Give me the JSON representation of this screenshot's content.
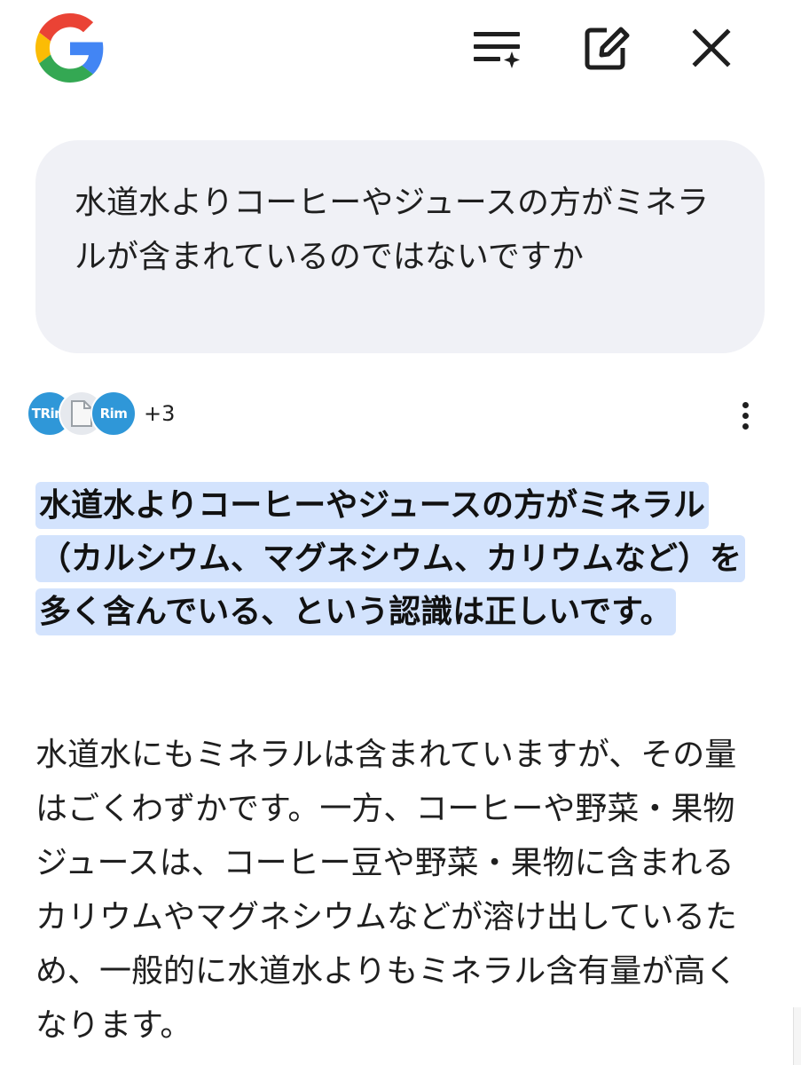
{
  "header": {
    "logo_icon": "google-g-logo-icon",
    "actions": [
      {
        "name": "sparkle-list-icon"
      },
      {
        "name": "edit-icon"
      },
      {
        "name": "close-icon"
      }
    ]
  },
  "user_query": {
    "text": "水道水よりコーヒーやジュースの方がミネラルが含まれているのではないですか"
  },
  "sources": {
    "avatars": [
      {
        "label": "TRim"
      },
      {
        "label": ""
      },
      {
        "label": "Rim"
      }
    ],
    "more_count": "+3"
  },
  "answer": {
    "highlight": "水道水よりコーヒーやジュースの方がミネラル（カルシウム、マグネシウム、カリウムなど）を多く含んでいる、という認識は正しいです。",
    "body": "水道水にもミネラルは含まれていますが、その量はごくわずかです。一方、コーヒーや野菜・果物ジュースは、コーヒー豆や野菜・果物に含まれるカリウムやマグネシウムなどが溶け出しているため、一般的に水道水よりもミネラル含有量が高くなります。"
  },
  "colors": {
    "bubble_bg": "#f0f1f6",
    "highlight_bg": "#d3e3fd",
    "avatar_blue": "#2f97d8"
  }
}
